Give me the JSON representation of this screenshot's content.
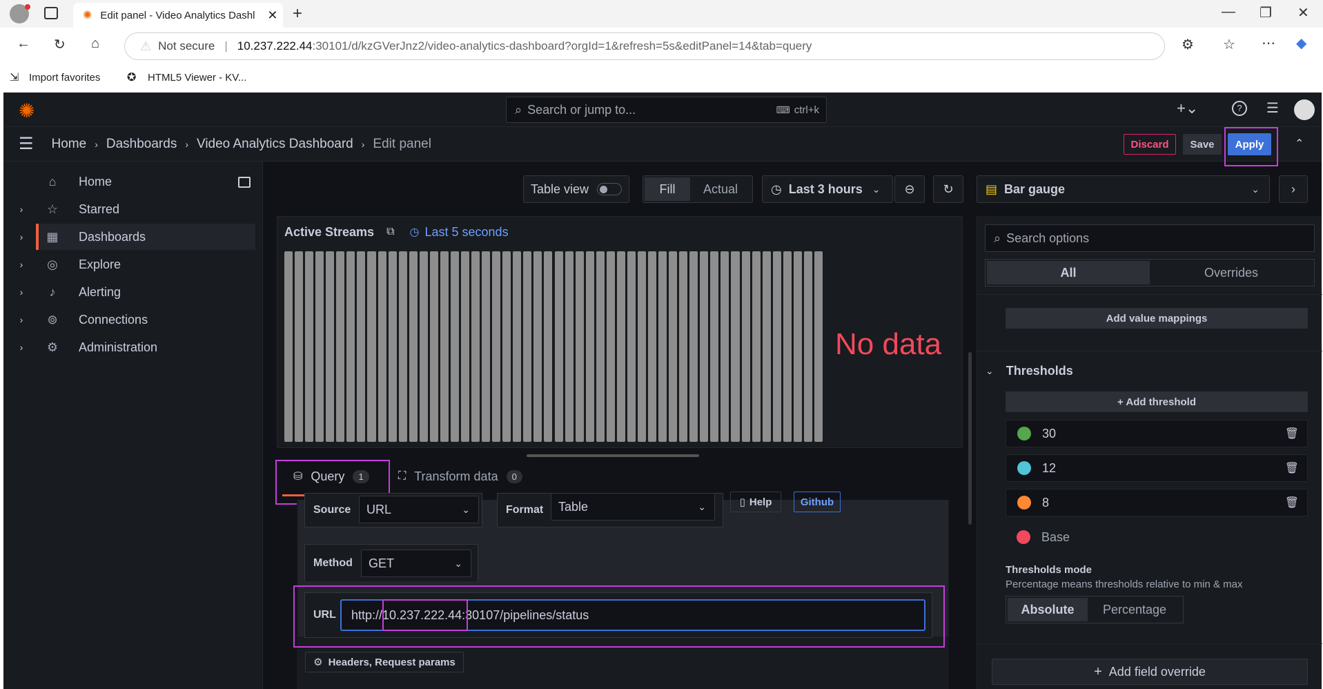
{
  "browser": {
    "tab_title": "Edit panel - Video Analytics Dashl",
    "not_secure": "Not secure",
    "url_host": "10.237.222.44",
    "url_rest": ":30101/d/kzGVerJnz2/video-analytics-dashboard?orgId=1&refresh=5s&editPanel=14&tab=query",
    "favorites": [
      "Import favorites",
      "HTML5 Viewer - KV..."
    ]
  },
  "grafana": {
    "search_placeholder": "Search or jump to...",
    "search_shortcut": "ctrl+k",
    "breadcrumbs": [
      "Home",
      "Dashboards",
      "Video Analytics Dashboard",
      "Edit panel"
    ],
    "actions": {
      "discard": "Discard",
      "save": "Save",
      "apply": "Apply"
    },
    "nav": [
      {
        "label": "Home",
        "icon": "home-icon"
      },
      {
        "label": "Starred",
        "icon": "star-icon"
      },
      {
        "label": "Dashboards",
        "icon": "grid-icon"
      },
      {
        "label": "Explore",
        "icon": "compass-icon"
      },
      {
        "label": "Alerting",
        "icon": "bell-icon"
      },
      {
        "label": "Connections",
        "icon": "connections-icon"
      },
      {
        "label": "Administration",
        "icon": "gear-icon"
      }
    ],
    "toolbar": {
      "table_view": "Table view",
      "fill": "Fill",
      "actual": "Actual",
      "time_range": "Last 3 hours",
      "visualization": "Bar gauge"
    },
    "panel": {
      "title": "Active Streams",
      "time_info": "Last 5 seconds",
      "no_data": "No data",
      "bar_count": 52,
      "bar_color": "#8e8e8e"
    },
    "query_tabs": {
      "query_label": "Query",
      "query_count": "1",
      "transform_label": "Transform data",
      "transform_count": "0"
    },
    "query_editor": {
      "source_label": "Source",
      "source_value": "URL",
      "format_label": "Format",
      "format_value": "Table",
      "help": "Help",
      "github": "Github",
      "method_label": "Method",
      "method_value": "GET",
      "url_label": "URL",
      "url_prefix": "http://",
      "url_host": "10.237.222.44",
      "url_suffix": ":30107/pipelines/status",
      "headers_button": "Headers, Request params"
    },
    "options": {
      "search_placeholder": "Search options",
      "tab_all": "All",
      "tab_overrides": "Overrides",
      "add_value_mappings": "Add value mappings",
      "thresholds_title": "Thresholds",
      "add_threshold": "+ Add threshold",
      "thresholds": [
        {
          "value": "30",
          "color": "#56a64b"
        },
        {
          "value": "12",
          "color": "#50c4d9"
        },
        {
          "value": "8",
          "color": "#ff8833"
        },
        {
          "value": "Base",
          "color": "#f2495c"
        }
      ],
      "thresholds_mode_title": "Thresholds mode",
      "thresholds_mode_desc": "Percentage means thresholds relative to min & max",
      "mode_absolute": "Absolute",
      "mode_percentage": "Percentage",
      "add_field_override": "Add field override"
    }
  }
}
